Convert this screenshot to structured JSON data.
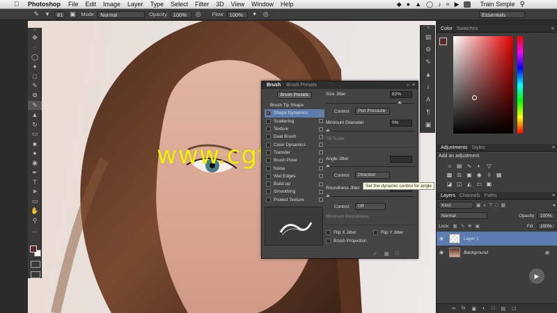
{
  "menubar": {
    "app": "Photoshop",
    "items": [
      "File",
      "Edit",
      "Image",
      "Layer",
      "Type",
      "Select",
      "Filter",
      "3D",
      "View",
      "Window",
      "Help"
    ],
    "user": "Train Simple"
  },
  "options": {
    "brush_size": "81",
    "mode_label": "Mode:",
    "mode_value": "Normal",
    "opacity_label": "Opacity:",
    "opacity_value": "100%",
    "flow_label": "Flow:",
    "flow_value": "100%",
    "workspace": "Essentials"
  },
  "watermark": "www.cgtsj.com",
  "brush_panel": {
    "tabs": [
      "Brush",
      "Brush Presets"
    ],
    "presets_button": "Brush Presets",
    "tip_shape": "Brush Tip Shape",
    "options": [
      {
        "label": "Shape Dynamics",
        "checked": true,
        "selected": true
      },
      {
        "label": "Scattering",
        "checked": false
      },
      {
        "label": "Texture",
        "checked": false
      },
      {
        "label": "Dual Brush",
        "checked": false
      },
      {
        "label": "Color Dynamics",
        "checked": false
      },
      {
        "label": "Transfer",
        "checked": false
      },
      {
        "label": "Brush Pose",
        "checked": false
      },
      {
        "label": "Noise",
        "checked": false
      },
      {
        "label": "Wet Edges",
        "checked": false
      },
      {
        "label": "Build-up",
        "checked": false
      },
      {
        "label": "Smoothing",
        "checked": false
      },
      {
        "label": "Protect Texture",
        "checked": false
      }
    ],
    "size_jitter_label": "Size Jitter",
    "size_jitter_value": "82%",
    "control_label": "Control:",
    "control1": "Pen Pressure",
    "min_diameter_label": "Minimum Diameter",
    "min_diameter_value": "0%",
    "tilt_scale_label": "Tilt Scale",
    "angle_jitter_label": "Angle Jitter",
    "control2": "Direction",
    "tooltip": "Set the dynamic control for angle",
    "roundness_jitter_label": "Roundness Jitter",
    "control3": "Off",
    "min_roundness_label": "Minimum Roundness",
    "flip_x": "Flip X Jitter",
    "flip_y": "Flip Y Jitter",
    "brush_projection": "Brush Projection"
  },
  "color_panel": {
    "tabs": [
      "Color",
      "Swatches"
    ]
  },
  "adjustments": {
    "tabs": [
      "Adjustments",
      "Styles"
    ],
    "title": "Add an adjustment"
  },
  "layers": {
    "tabs": [
      "Layers",
      "Channels",
      "Paths"
    ],
    "kind": "Kind",
    "blend": "Normal",
    "opacity_label": "Opacity:",
    "opacity_value": "100%",
    "lock_label": "Lock:",
    "fill_label": "Fill:",
    "fill_value": "100%",
    "items": [
      {
        "name": "Layer 1",
        "selected": true
      },
      {
        "name": "Background",
        "selected": false
      }
    ]
  },
  "colors": {
    "foreground": "#5a2a2a",
    "selection": "#5a7cb0",
    "watermark": "#f3f000"
  }
}
